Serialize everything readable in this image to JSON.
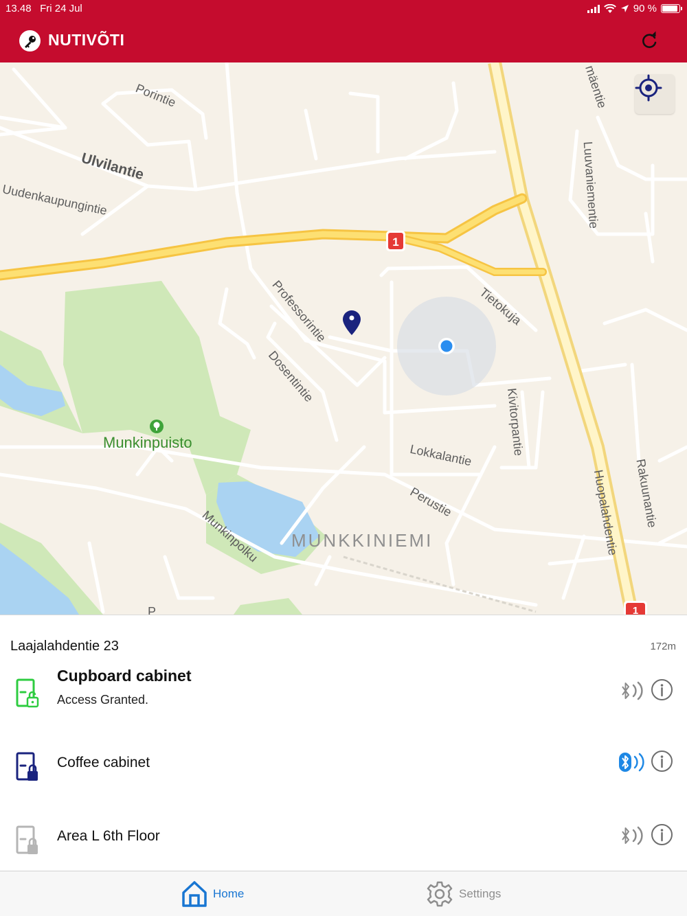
{
  "status_bar": {
    "time": "13.48",
    "date": "Fri 24 Jul",
    "battery": "90 %"
  },
  "header": {
    "title": "NUTIVÕTI",
    "brand_color": "#c50c2e"
  },
  "map": {
    "labels": {
      "porintie": "Porintie",
      "ulvilantie": "Ulvilantie",
      "uudenkaupungintie": "Uudenkaupungintie",
      "professorintie": "Professorintie",
      "dosentintie": "Dosentintie",
      "tietokuja": "Tietokuja",
      "munkinpuisto": "Munkinpuisto",
      "lokkalantie": "Lokkalantie",
      "perustie": "Perustie",
      "munkinpolku": "Munkinpolku",
      "munkkiniemi": "MUNKKINIEMI",
      "kivitorpantie": "Kivitorpantie",
      "huopalahdentie": "Huopalahdentie",
      "rakuunantie": "Rakuunantie",
      "luuvaniementie": "Luuvaniementie",
      "maentie": "mäentie",
      "road_badge": "1",
      "road_badge_2": "1",
      "partial_p": "P"
    }
  },
  "location": {
    "address": "Laajalahdentie 23",
    "distance": "172m"
  },
  "locks": [
    {
      "name": "Cupboard cabinet",
      "status": "Access Granted.",
      "state": "granted",
      "color": "#2ecc40"
    },
    {
      "name": "Coffee cabinet",
      "status": "",
      "state": "locked",
      "color": "#1a237e"
    },
    {
      "name": "Area L 6th Floor",
      "status": "",
      "state": "unavailable",
      "color": "#b5b5b5"
    }
  ],
  "tabs": [
    {
      "label": "Home",
      "active": true,
      "color": "#1976d2",
      "icon": "home-icon"
    },
    {
      "label": "Settings",
      "active": false,
      "color": "#8e8e8e",
      "icon": "gear-icon"
    }
  ]
}
